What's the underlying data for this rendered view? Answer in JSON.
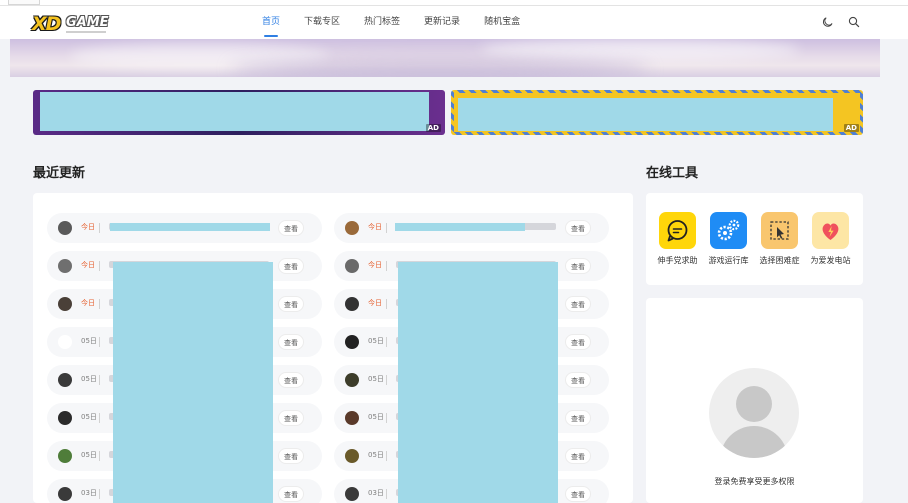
{
  "nav": {
    "logo_text_1": "XD",
    "logo_text_2": "GAME",
    "items": [
      {
        "label": "首页"
      },
      {
        "label": "下载专区"
      },
      {
        "label": "热门标签"
      },
      {
        "label": "更新记录"
      },
      {
        "label": "随机宝盒"
      }
    ],
    "icons": [
      "moon-icon",
      "search-icon"
    ]
  },
  "ads": {
    "left_tag": "AD",
    "right_tag": "AD"
  },
  "sections": {
    "recent_title": "最近更新",
    "tools_title": "在线工具"
  },
  "recent": {
    "view_label": "查看",
    "left": [
      {
        "date": "今日",
        "today": true,
        "avatar_color": "#5a5a5a"
      },
      {
        "date": "今日",
        "today": true,
        "avatar_color": "#6f6f6f"
      },
      {
        "date": "今日",
        "today": true,
        "avatar_color": "#4a4038"
      },
      {
        "date": "05日",
        "today": false,
        "avatar_color": "#ffffff"
      },
      {
        "date": "05日",
        "today": false,
        "avatar_color": "#3a3a3a"
      },
      {
        "date": "05日",
        "today": false,
        "avatar_color": "#2b2b2b"
      },
      {
        "date": "05日",
        "today": false,
        "avatar_color": "#4f7d3a"
      },
      {
        "date": "03日",
        "today": false,
        "avatar_color": "#3a3a3a"
      }
    ],
    "right": [
      {
        "date": "今日",
        "today": true,
        "avatar_color": "#9a6a3a"
      },
      {
        "date": "今日",
        "today": true,
        "avatar_color": "#6a6a6a"
      },
      {
        "date": "今日",
        "today": true,
        "avatar_color": "#333333"
      },
      {
        "date": "05日",
        "today": false,
        "avatar_color": "#222222"
      },
      {
        "date": "05日",
        "today": false,
        "avatar_color": "#3d3d2a"
      },
      {
        "date": "05日",
        "today": false,
        "avatar_color": "#5a3a2a"
      },
      {
        "date": "05日",
        "today": false,
        "avatar_color": "#6a5a2a"
      },
      {
        "date": "03日",
        "today": false,
        "avatar_color": "#3a3a3a"
      }
    ]
  },
  "tools": [
    {
      "label": "伸手党求助",
      "color": "#ffd60a",
      "icon": "chat-bubble-icon"
    },
    {
      "label": "游戏运行库",
      "color": "#1f8cf5",
      "icon": "gears-icon"
    },
    {
      "label": "选择困难症",
      "color": "#f9c66e",
      "icon": "cursor-select-icon"
    },
    {
      "label": "为爱发电站",
      "color": "#fde6a5",
      "icon": "heart-bolt-icon"
    }
  ],
  "login": {
    "prompt": "登录免费享受更多权限"
  }
}
